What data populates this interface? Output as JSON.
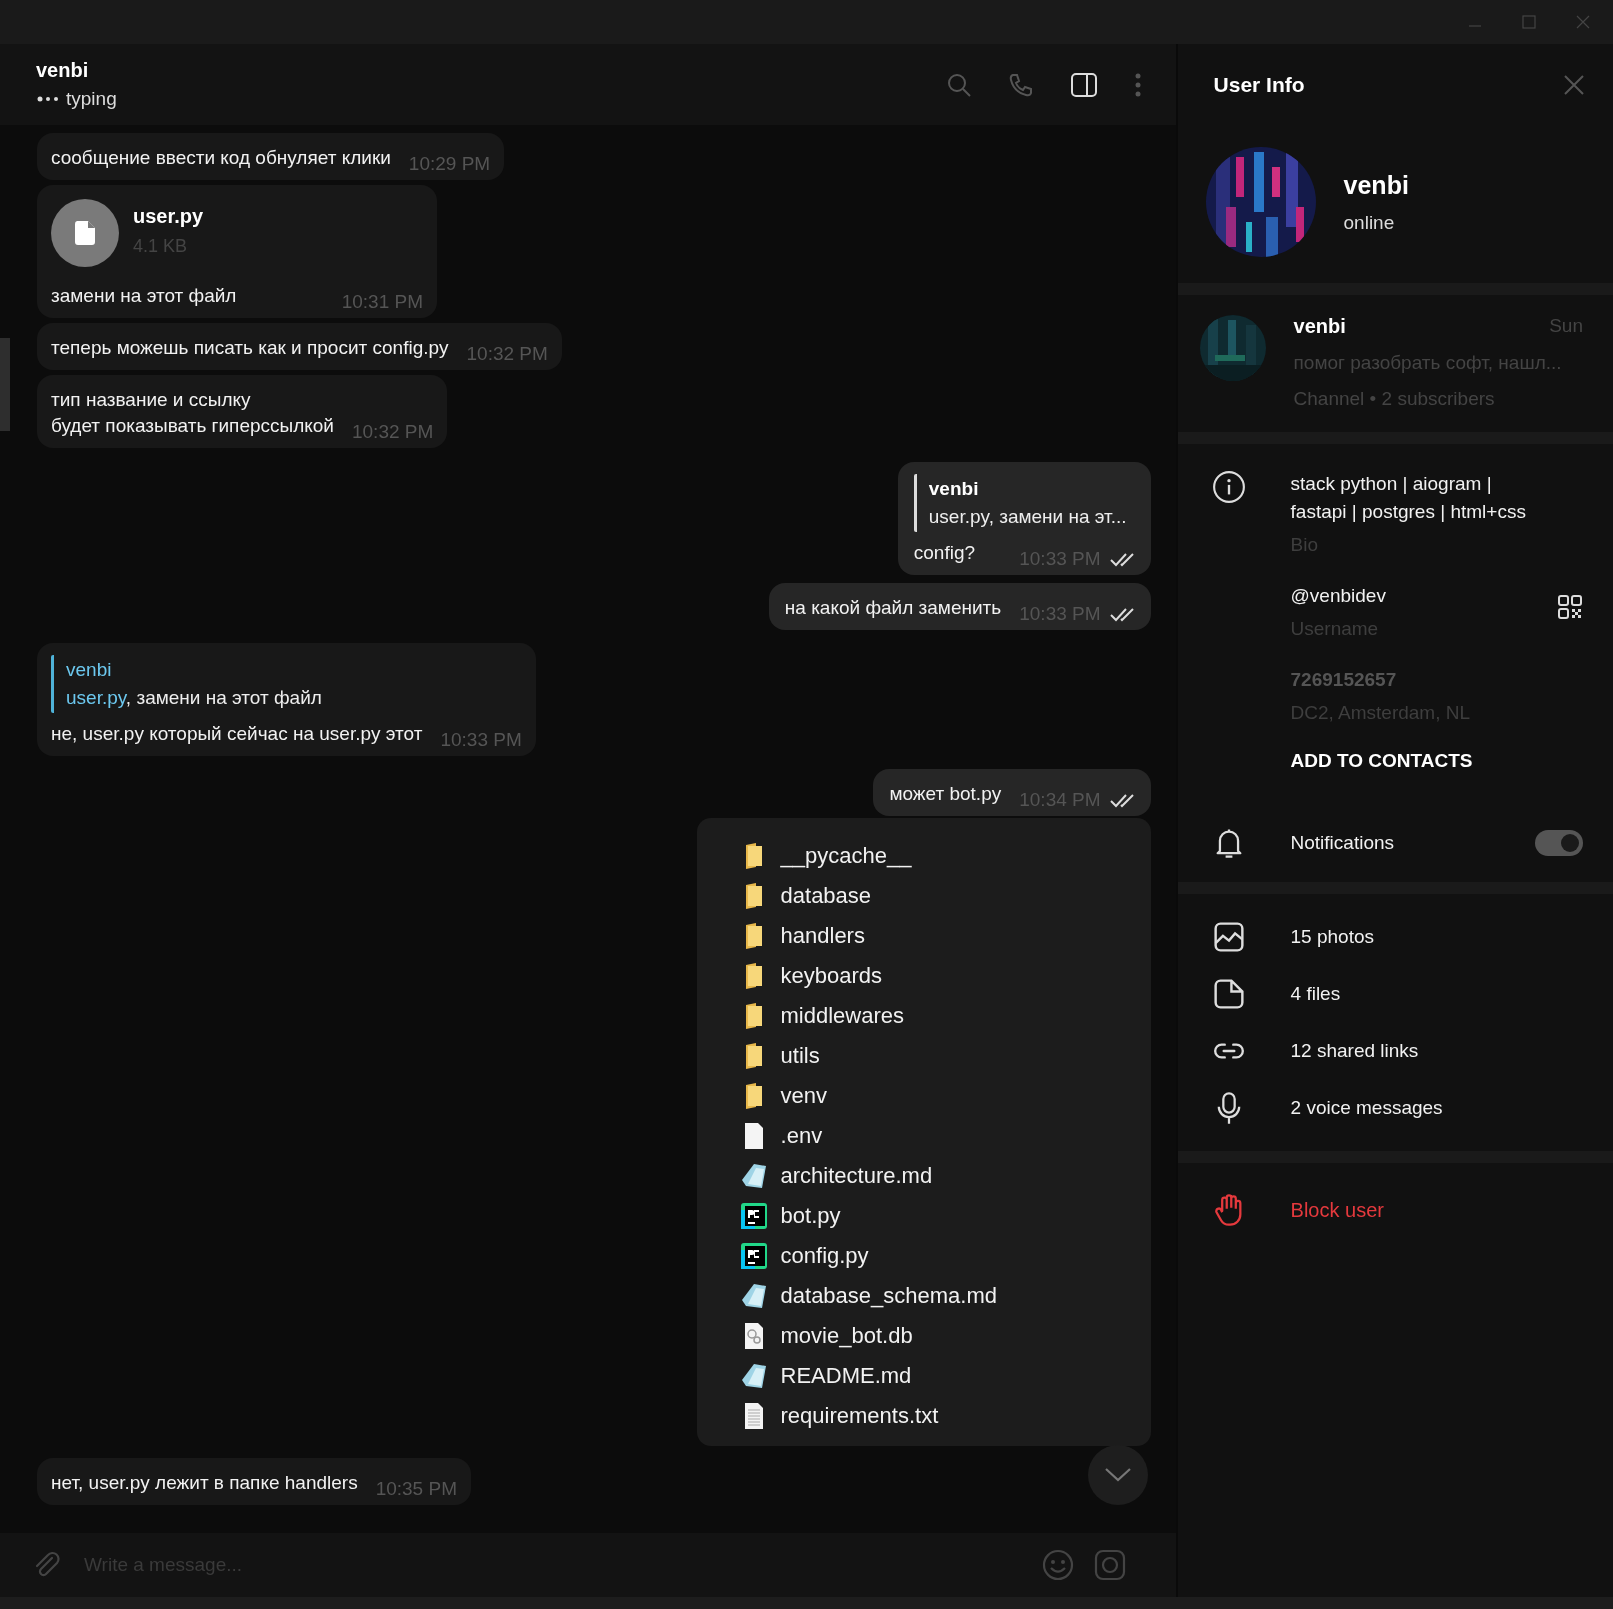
{
  "chat": {
    "title": "venbi",
    "status": "typing"
  },
  "messages": [
    {
      "kind": "text",
      "outgoing": false,
      "text": "сообщение ввести код обнуляет клики",
      "time": "10:29 PM"
    },
    {
      "kind": "file",
      "outgoing": false,
      "file_name": "user.py",
      "file_size": "4.1 KB",
      "text": "замени на этот файл",
      "time": "10:31 PM"
    },
    {
      "kind": "text",
      "outgoing": false,
      "text": "теперь можешь писать как и просит config.py",
      "time": "10:32 PM"
    },
    {
      "kind": "text",
      "outgoing": false,
      "text": "тип название и ссылку\nбудет показывать гиперссылкой",
      "time": "10:32 PM"
    },
    {
      "kind": "reply",
      "outgoing": true,
      "quote_author": "venbi",
      "quote_text": "user.py, замени на эт...",
      "text": "config?",
      "time": "10:33 PM",
      "read": true
    },
    {
      "kind": "text",
      "outgoing": true,
      "text": "на какой файл заменить",
      "time": "10:33 PM",
      "read": true
    },
    {
      "kind": "reply",
      "outgoing": false,
      "quote_author": "venbi",
      "quote_link": "user.py",
      "quote_text": ", замени на этот файл",
      "text": "не, user.py который сейчас на user.py этот",
      "time": "10:33 PM"
    },
    {
      "kind": "text",
      "outgoing": true,
      "text": "может bot.py",
      "time": "10:34 PM",
      "read": true
    },
    {
      "kind": "screenshot",
      "outgoing": true,
      "files": [
        {
          "name": "__pycache__",
          "kind": "folder"
        },
        {
          "name": "database",
          "kind": "folder"
        },
        {
          "name": "handlers",
          "kind": "folder"
        },
        {
          "name": "keyboards",
          "kind": "folder"
        },
        {
          "name": "middlewares",
          "kind": "folder"
        },
        {
          "name": "utils",
          "kind": "folder"
        },
        {
          "name": "venv",
          "kind": "folder"
        },
        {
          "name": ".env",
          "kind": "blank"
        },
        {
          "name": "architecture.md",
          "kind": "markdown"
        },
        {
          "name": "bot.py",
          "kind": "python"
        },
        {
          "name": "config.py",
          "kind": "python"
        },
        {
          "name": "database_schema.md",
          "kind": "markdown"
        },
        {
          "name": "movie_bot.db",
          "kind": "database"
        },
        {
          "name": "README.md",
          "kind": "markdown"
        },
        {
          "name": "requirements.txt",
          "kind": "text"
        }
      ]
    },
    {
      "kind": "text",
      "outgoing": false,
      "text": "нет, user.py лежит в папке handlers",
      "time": "10:35 PM"
    }
  ],
  "composer": {
    "placeholder": "Write a message..."
  },
  "user_info": {
    "title": "User Info",
    "name": "venbi",
    "status": "online",
    "channel": {
      "name": "venbi",
      "date": "Sun",
      "preview": "помог разобрать софт, нашл...",
      "meta": "Channel • 2 subscribers"
    },
    "bio": {
      "value": "stack python | aiogram | fastapi | postgres | html+css",
      "label": "Bio"
    },
    "username": {
      "value": "@venbidev",
      "label": "Username"
    },
    "id": {
      "value": "7269152657",
      "label": "DC2, Amsterdam, NL"
    },
    "add_contact": "ADD TO CONTACTS",
    "notifications": {
      "label": "Notifications",
      "on": true
    },
    "media": [
      {
        "kind": "photos",
        "label": "15 photos"
      },
      {
        "kind": "files",
        "label": "4 files"
      },
      {
        "kind": "links",
        "label": "12 shared links"
      },
      {
        "kind": "voice",
        "label": "2 voice messages"
      }
    ],
    "block": "Block user"
  }
}
